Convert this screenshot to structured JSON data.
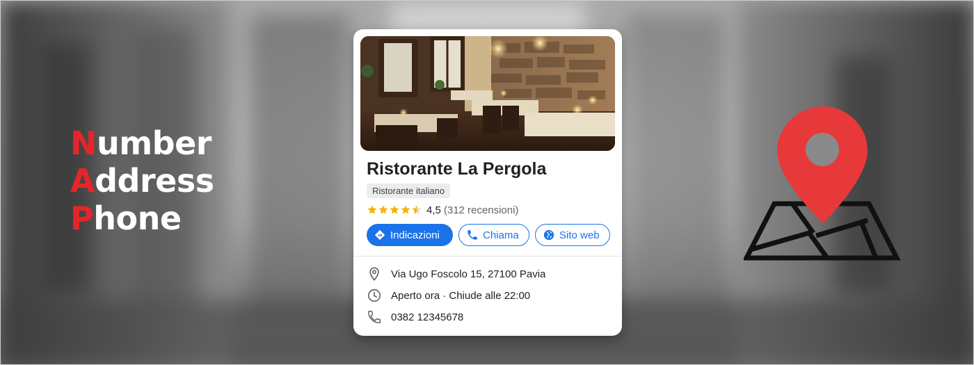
{
  "nap": {
    "lines": [
      {
        "first": "N",
        "rest": "umber"
      },
      {
        "first": "A",
        "rest": "ddress"
      },
      {
        "first": "P",
        "rest": "hone"
      }
    ]
  },
  "card": {
    "title": "Ristorante La Pergola",
    "category": "Ristorante italiano",
    "rating": "4,5",
    "rating_stars": 4.5,
    "reviews": "(312 recensioni)",
    "actions": {
      "directions": "Indicazioni",
      "call": "Chiama",
      "website": "Sito web"
    },
    "address": "Via Ugo Foscolo 15, 27100 Pavia",
    "hours": "Aperto ora · Chiude alle 22:00",
    "phone": "0382 12345678"
  },
  "colors": {
    "accent_red": "#e8242b",
    "link_blue": "#1a73e8",
    "star_gold": "#f4b400",
    "pin_red": "#e8393a"
  },
  "icons": {
    "directions": "directions-icon",
    "call": "phone-icon",
    "website": "globe-icon",
    "address": "location-pin-icon",
    "hours": "clock-icon",
    "phone": "phone-icon",
    "map": "map-pin-icon"
  }
}
